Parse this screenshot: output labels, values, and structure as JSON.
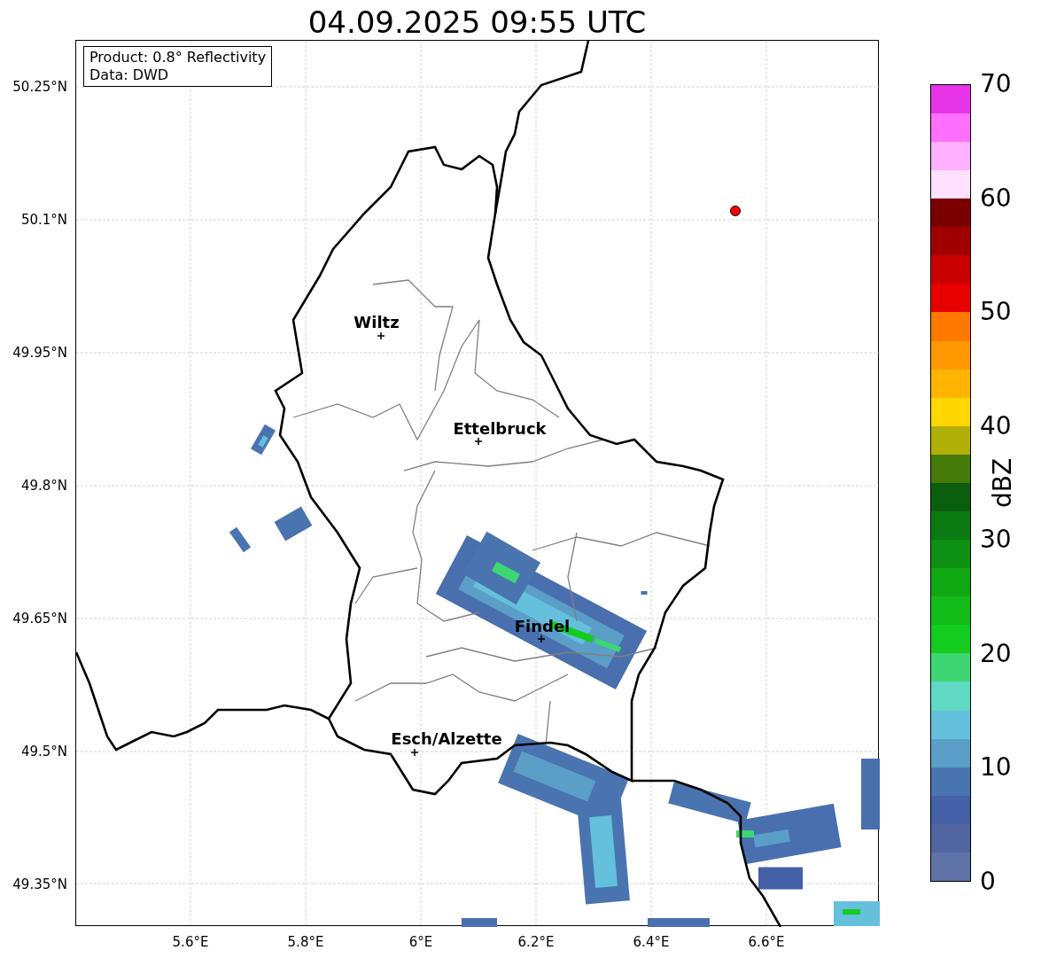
{
  "title": "04.09.2025 09:55 UTC",
  "info_box": [
    "Product: 0.8° Reflectivity",
    "Data: DWD"
  ],
  "lat_ticks": [
    "50.25°N",
    "50.1°N",
    "49.95°N",
    "49.8°N",
    "49.65°N",
    "49.5°N",
    "49.35°N"
  ],
  "lon_ticks": [
    "5.6°E",
    "5.8°E",
    "6°E",
    "6.2°E",
    "6.4°E",
    "6.6°E"
  ],
  "cities": [
    {
      "name": "Wiltz"
    },
    {
      "name": "Ettelbruck"
    },
    {
      "name": "Findel"
    },
    {
      "name": "Esch/Alzette"
    }
  ],
  "colorbar": {
    "label": "dBZ",
    "ticks": [
      "70",
      "60",
      "50",
      "40",
      "30",
      "20",
      "10",
      "0"
    ],
    "bands": [
      {
        "color": "#6073a8"
      },
      {
        "color": "#5064a0"
      },
      {
        "color": "#4560a6"
      },
      {
        "color": "#4a74b0"
      },
      {
        "color": "#5b9ec8"
      },
      {
        "color": "#64c0dc"
      },
      {
        "color": "#5fd8c4"
      },
      {
        "color": "#3ed672"
      },
      {
        "color": "#13cc1e"
      },
      {
        "color": "#12bb18"
      },
      {
        "color": "#10a812"
      },
      {
        "color": "#0e9012"
      },
      {
        "color": "#0b7a12"
      },
      {
        "color": "#0a5e0e"
      },
      {
        "color": "#467a0a"
      },
      {
        "color": "#b0b008"
      },
      {
        "color": "#ffd700"
      },
      {
        "color": "#ffb400"
      },
      {
        "color": "#ff9800"
      },
      {
        "color": "#ff7800"
      },
      {
        "color": "#e60000"
      },
      {
        "color": "#c80000"
      },
      {
        "color": "#a00000"
      },
      {
        "color": "#7a0000"
      },
      {
        "color": "#ffe0ff"
      },
      {
        "color": "#ffb0ff"
      },
      {
        "color": "#ff70ff"
      },
      {
        "color": "#e834e8"
      }
    ]
  }
}
